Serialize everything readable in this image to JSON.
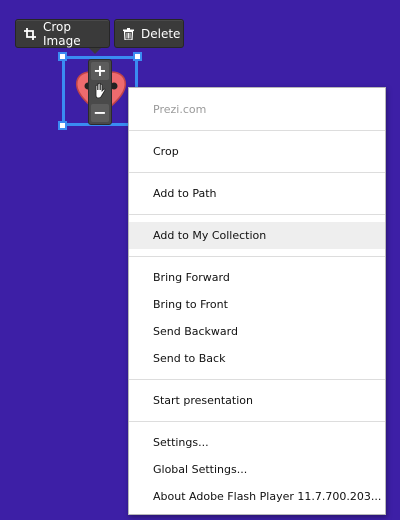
{
  "toolbar": {
    "crop_label": "Crop Image",
    "delete_label": "Delete",
    "crop_icon": "crop-icon",
    "delete_icon": "trash-icon"
  },
  "zoom": {
    "zoom_in": "+",
    "zoom_out": "−",
    "pan_icon": "hand-icon"
  },
  "menu": {
    "header": "Prezi.com",
    "items": {
      "crop": "Crop",
      "add_to_path": "Add to Path",
      "add_to_collection": "Add to My Collection",
      "bring_forward": "Bring Forward",
      "bring_to_front": "Bring to Front",
      "send_backward": "Send Backward",
      "send_to_back": "Send to Back",
      "start_presentation": "Start presentation",
      "settings": "Settings...",
      "global_settings": "Global Settings...",
      "about": "About Adobe Flash Player 11.7.700.203..."
    }
  },
  "colors": {
    "canvas": "#3d1fa6",
    "selection": "#3a8cf2",
    "toolbar": "#3a3a3a",
    "menu_hover": "#eeeeee"
  }
}
